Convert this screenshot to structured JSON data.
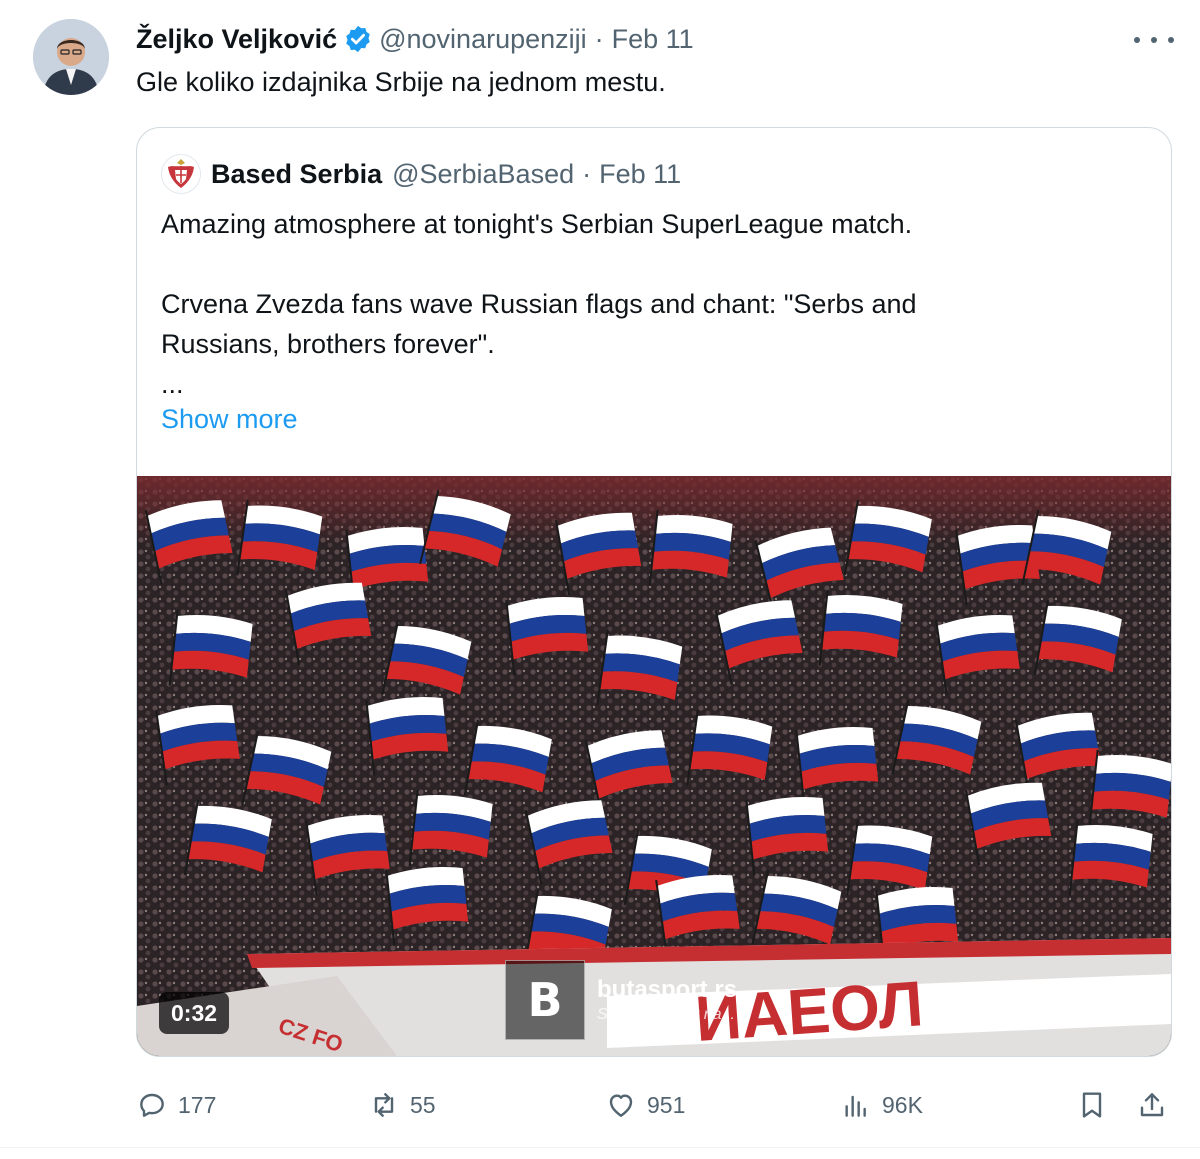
{
  "author": {
    "display_name": "Željko Veljković",
    "handle": "@novinarupenziji",
    "separator": "·",
    "date": "Feb 11",
    "avatar_icon": "profile-photo"
  },
  "tweet": {
    "text": "Gle koliko izdajnika Srbije na jednom mestu."
  },
  "quoted": {
    "display_name": "Based Serbia",
    "handle": "@SerbiaBased",
    "separator": "·",
    "date": "Feb 11",
    "avatar_icon": "serbian-coat-of-arms",
    "text_lines": [
      "Amazing atmosphere at tonight's Serbian SuperLeague match.",
      "Crvena Zvezda fans wave Russian flags and chant: \"Serbs and",
      "Russians, brothers forever\".",
      "..."
    ],
    "show_more": "Show more",
    "video": {
      "duration": "0:32",
      "watermark_logo": "B",
      "watermark_site": "butasport.rs",
      "watermark_tagline": "Sa nama uvek na..."
    }
  },
  "actions": {
    "replies": "177",
    "reposts": "55",
    "likes": "951",
    "views": "96K"
  },
  "colors": {
    "link": "#1d9bf0",
    "secondary_text": "#536471",
    "verified": "#1d9bf0",
    "flag_white": "#ffffff",
    "flag_blue": "#1c3f9a",
    "flag_red": "#d62828"
  }
}
